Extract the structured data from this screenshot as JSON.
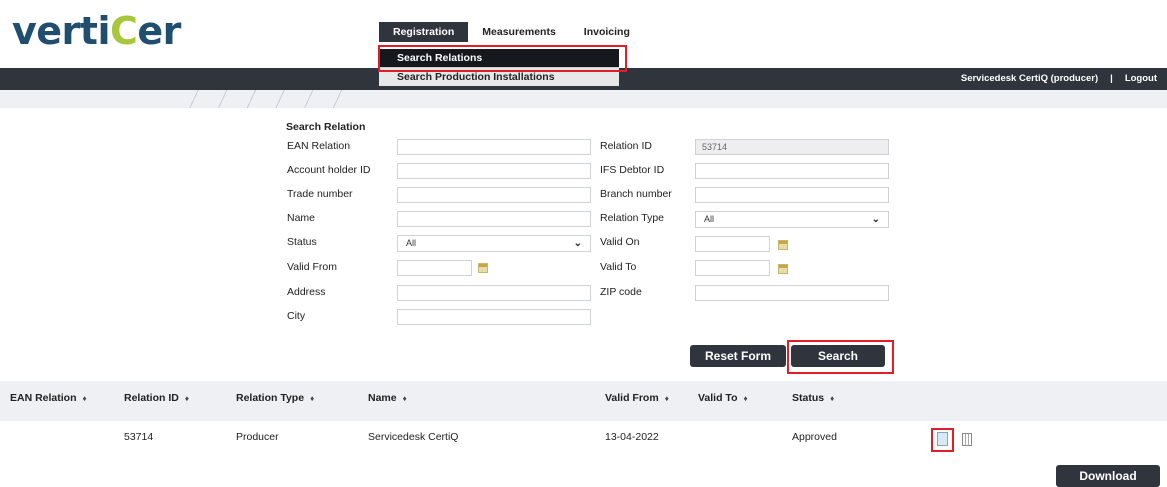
{
  "brand": {
    "logo_left": "verti",
    "logo_mid": "C",
    "logo_right": "er"
  },
  "top_menu": {
    "registration": "Registration",
    "measurements": "Measurements",
    "invoicing": "Invoicing"
  },
  "dropdown": {
    "search_relations": "Search Relations",
    "search_production": "Search Production Installations"
  },
  "user_bar": {
    "user": "Servicedesk CertiQ (producer)",
    "separator": "|",
    "logout": "Logout"
  },
  "form": {
    "title": "Search Relation",
    "ean_relation": {
      "label": "EAN Relation",
      "value": ""
    },
    "account_holder_id": {
      "label": "Account holder ID",
      "value": ""
    },
    "trade_number": {
      "label": "Trade number",
      "value": ""
    },
    "name": {
      "label": "Name",
      "value": ""
    },
    "status": {
      "label": "Status",
      "value": "All"
    },
    "valid_from": {
      "label": "Valid From",
      "value": ""
    },
    "address": {
      "label": "Address",
      "value": ""
    },
    "city": {
      "label": "City",
      "value": ""
    },
    "relation_id": {
      "label": "Relation ID",
      "value": "53714"
    },
    "ifs_debtor_id": {
      "label": "IFS Debtor ID",
      "value": ""
    },
    "branch_number": {
      "label": "Branch number",
      "value": ""
    },
    "relation_type": {
      "label": "Relation Type",
      "value": "All"
    },
    "valid_on": {
      "label": "Valid On",
      "value": ""
    },
    "valid_to": {
      "label": "Valid To",
      "value": ""
    },
    "zip_code": {
      "label": "ZIP code",
      "value": ""
    },
    "reset_label": "Reset Form",
    "search_label": "Search"
  },
  "table": {
    "columns": [
      "EAN Relation",
      "Relation ID",
      "Relation Type",
      "Name",
      "Valid From",
      "Valid To",
      "Status"
    ],
    "sort_glyph": "♦",
    "rows": [
      {
        "ean_relation": "",
        "relation_id": "53714",
        "relation_type": "Producer",
        "name": "Servicedesk CertiQ",
        "valid_from": "13-04-2022",
        "valid_to": "",
        "status": "Approved"
      }
    ]
  },
  "download_label": "Download",
  "colors": {
    "dark_bar": "#2f343d",
    "highlight": "#e01e2a",
    "logo_blue": "#1f4e6e",
    "logo_green": "#a9c73a"
  },
  "icons": [
    "edit-document-icon",
    "delete-trash-icon",
    "calendar-icon",
    "chevron-down-icon",
    "sort-icon"
  ]
}
